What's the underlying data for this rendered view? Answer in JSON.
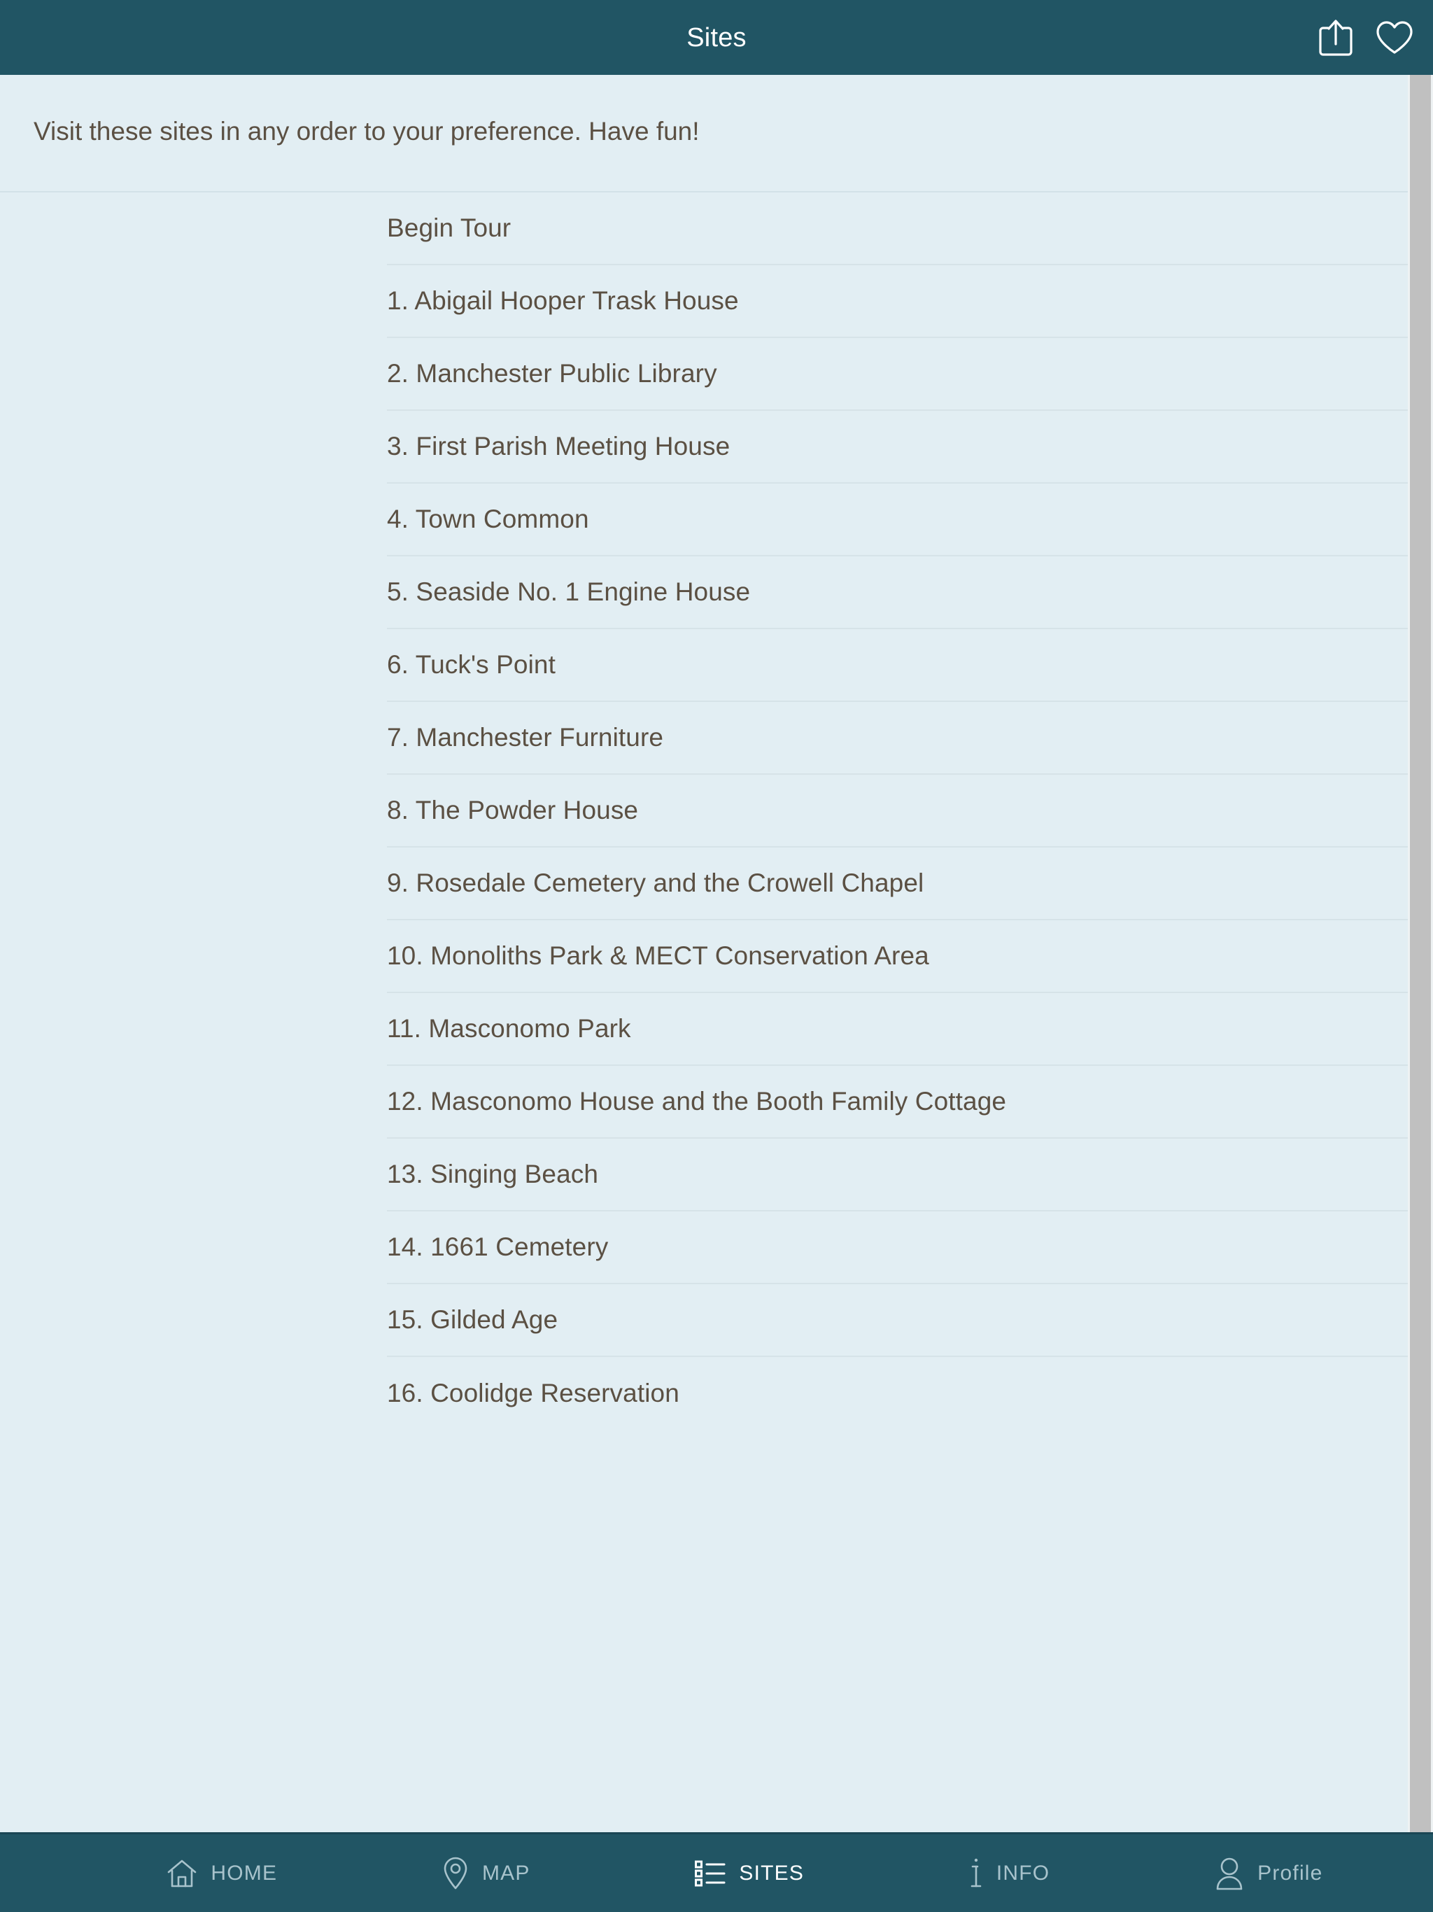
{
  "header": {
    "title": "Sites",
    "share_icon": "share-icon",
    "favorite_icon": "heart-icon"
  },
  "intro": {
    "text": "Visit these sites in any order to your preference. Have fun!"
  },
  "sites_list": {
    "begin_label": "Begin Tour",
    "items": [
      "1. Abigail Hooper Trask House",
      "2. Manchester Public Library",
      "3. First Parish Meeting House",
      "4. Town Common",
      "5. Seaside No. 1 Engine House",
      "6. Tuck's Point",
      "7. Manchester Furniture",
      "8. The Powder House",
      "9. Rosedale Cemetery and the Crowell Chapel",
      "10. Monoliths Park & MECT Conservation Area",
      "11. Masconomo Park",
      "12. Masconomo House and the Booth Family Cottage",
      "13. Singing Beach",
      "14. 1661 Cemetery",
      "15. Gilded Age",
      "16. Coolidge Reservation"
    ]
  },
  "tabbar": {
    "tabs": [
      {
        "label": "HOME",
        "icon": "home-icon",
        "active": false
      },
      {
        "label": "MAP",
        "icon": "map-pin-icon",
        "active": false
      },
      {
        "label": "SITES",
        "icon": "list-icon",
        "active": true
      },
      {
        "label": "INFO",
        "icon": "info-icon",
        "active": false
      },
      {
        "label": "Profile",
        "icon": "person-icon",
        "active": false
      }
    ]
  },
  "colors": {
    "header_bar": "#215564",
    "page_background": "#e2eef3",
    "body_text": "#5b5043",
    "divider": "#d6e3e8",
    "tab_inactive": "#a8c3cc",
    "tab_active": "#ffffff",
    "scrollbar_thumb": "#c0c0c0"
  }
}
